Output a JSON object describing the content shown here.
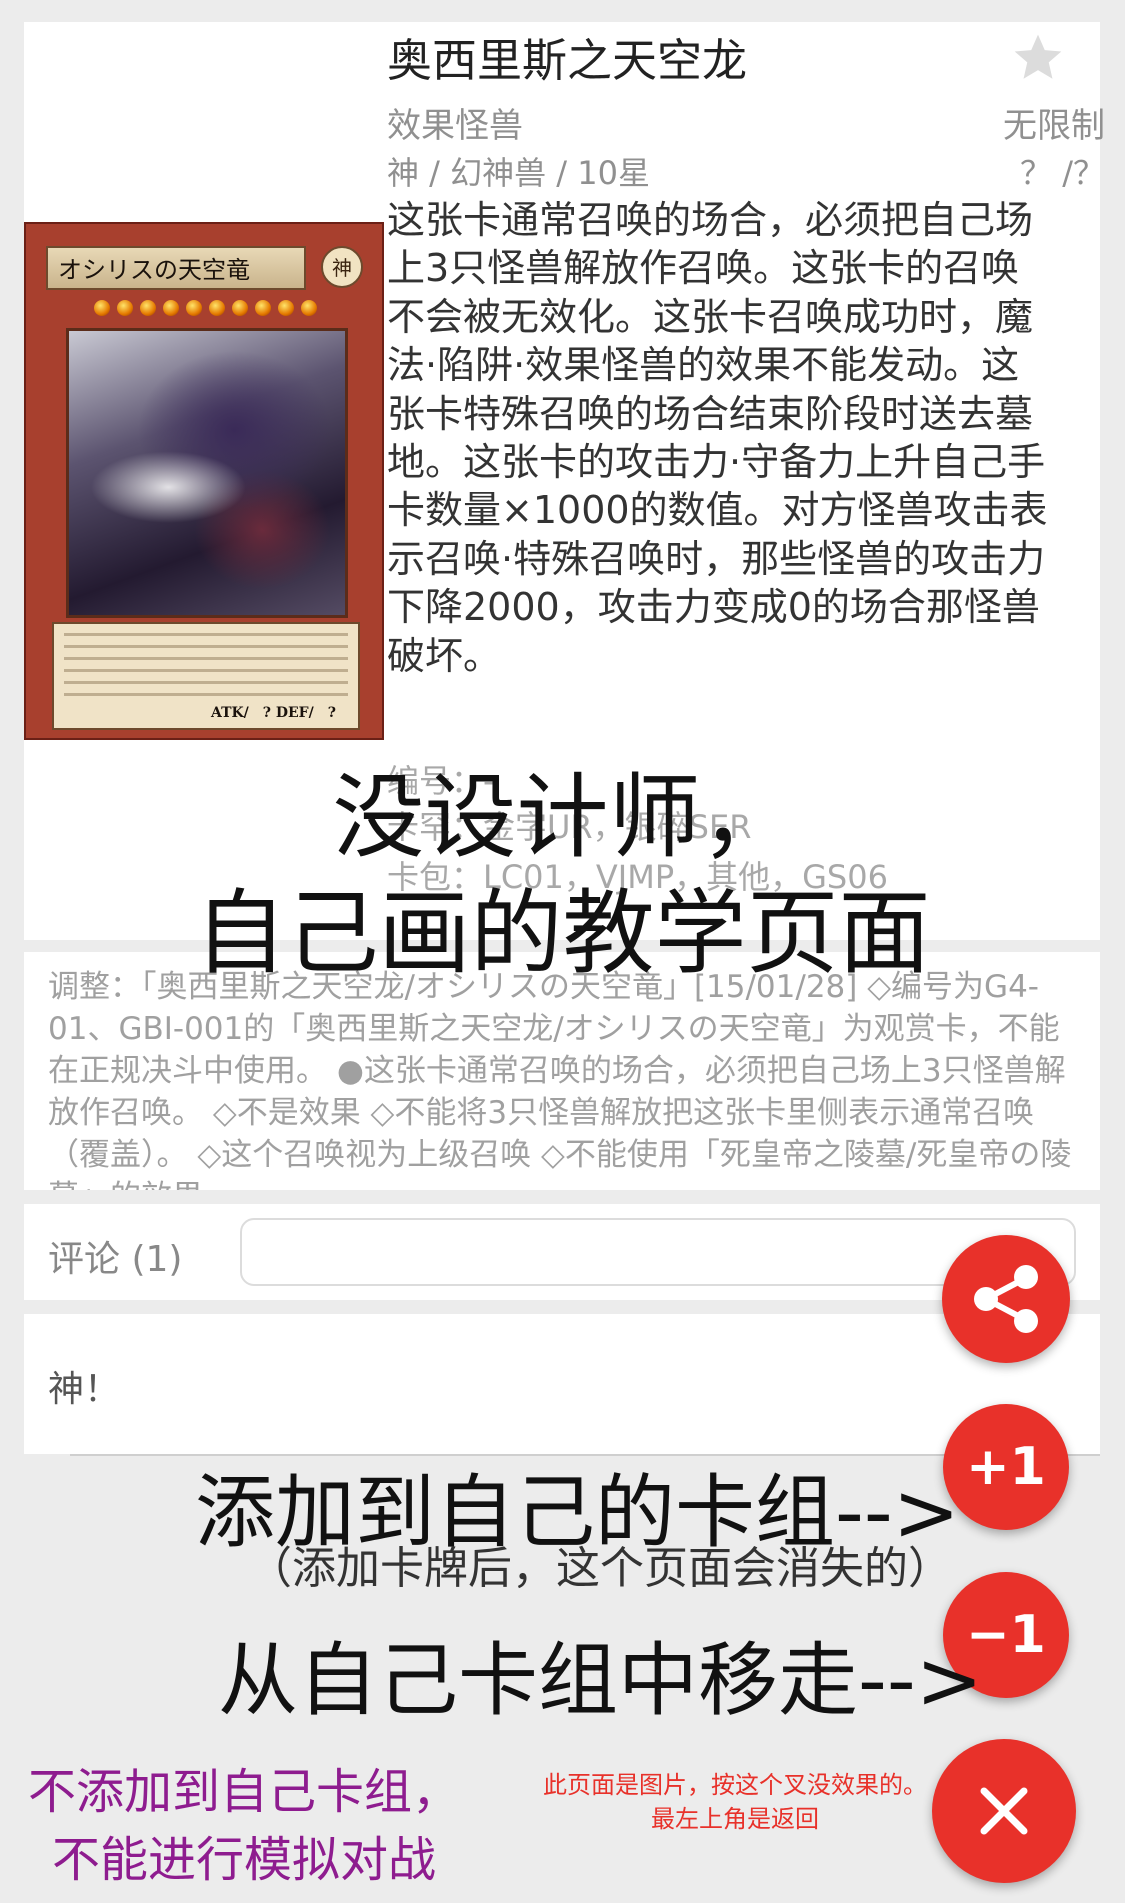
{
  "card": {
    "name": "奥西里斯之天空龙",
    "type": "效果怪兽",
    "limit": "无限制",
    "race_level": "神 / 幻神兽 / 10星",
    "atk_def": "？ /？",
    "effect": "这张卡通常召唤的场合，必须把自己场上3只怪兽解放作召唤。这张卡的召唤不会被无效化。这张卡召唤成功时，魔法·陷阱·效果怪兽的效果不能发动。这张卡特殊召唤的场合结束阶段时送去墓地。这张卡的攻击力·守备力上升自己手卡数量×1000的数值。对方怪兽攻击表示召唤·特殊召唤时，那些怪兽的攻击力下降2000，攻击力变成0的场合那怪兽破坏。",
    "number": "编号：-",
    "rarity": "卡罕：金字UR，银碎SER",
    "pack": "卡包：LC01，VJMP，其他，GS06",
    "image": {
      "name": "オシリスの天空竜",
      "attribute": "神",
      "level": 10,
      "stats": "ATK/　? DEF/　?"
    }
  },
  "ruling": {
    "text": "调整：「奥西里斯之天空龙/オシリスの天空竜」[15/01/28] ◇编号为G4-01、GBI-001的「奥西里斯之天空龙/オシリスの天空竜」为观赏卡，不能在正规决斗中使用。 ●这张卡通常召唤的场合，必须把自己场上3只怪兽解放作召唤。 ◇不是效果 ◇不能将3只怪兽解放把这张卡里侧表示通常召唤（覆盖）。 ◇这个召唤视为上级召唤 ◇不能使用「死皇帝之陵墓/死皇帝の陵墓」的效果"
  },
  "comments": {
    "label": "评论 (1)",
    "input_value": "",
    "items": [
      {
        "text": "神！"
      }
    ]
  },
  "fabs": {
    "share_icon": "share-icon",
    "plus_label": "+1",
    "minus_label": "−1",
    "close_icon": "close-icon",
    "color": "#e8312a"
  },
  "overlay": {
    "title_line1": "没设计师，",
    "title_line2": "自己画的教学页面",
    "add_text": "添加到自己的卡组-->",
    "add_note": "（添加卡牌后，这个页面会消失的）",
    "remove_text": "从自己卡组中移走-->",
    "purple_line1": "不添加到自己卡组，",
    "purple_line2": "不能进行模拟对战",
    "red_line1": "此页面是图片，按这个叉没效果的。",
    "red_line2": "最左上角是返回"
  }
}
